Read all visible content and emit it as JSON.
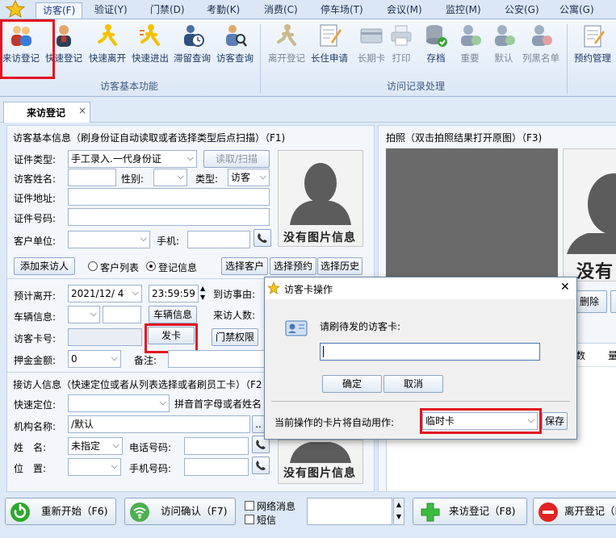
{
  "menu": {
    "tabs": [
      "访客(F)",
      "验证(Y)",
      "门禁(D)",
      "考勤(K)",
      "消费(C)",
      "停车场(T)",
      "会议(M)",
      "监控(M)",
      "公安(G)",
      "公寓(G)"
    ]
  },
  "ribbon": {
    "group1_label": "访客基本功能",
    "group2_label": "访问记录处理",
    "buttons": [
      "来访登记",
      "快速登记",
      "快速离开",
      "快速进出",
      "滞留查询",
      "访客查询",
      "离开登记",
      "长住申请",
      "长期卡",
      "打印",
      "存档",
      "重要",
      "默认",
      "列黑名单",
      "预约管理"
    ]
  },
  "doc_tab": {
    "label": "来访登记",
    "close": "×"
  },
  "visitor": {
    "section_title": "访客基本信息（刷身份证自动读取或者选择类型后点扫描）（F1)",
    "id_type_label": "证件类型:",
    "id_type_value": "手工录入.一代身份证",
    "read_scan": "读取/扫描",
    "name_label": "访客姓名:",
    "gender_label": "性别:",
    "type_label": "类型:",
    "type_value": "访客",
    "address_label": "证件地址:",
    "id_number_label": "证件号码:",
    "company_label": "客户单位:",
    "phone_label": "手机:",
    "no_photo": "没有图片信息",
    "add_visitor": "添加来访人",
    "radio_client_list": "客户列表",
    "radio_registered": "登记信息",
    "select_client": "选择客户",
    "select_booking": "选择预约",
    "select_history": "选择历史"
  },
  "visit": {
    "expected_leave_label": "预计离开:",
    "date_value": "2021/12/  4",
    "time_value": "23:59:59",
    "reason_label": "到访事由:",
    "vehicle_label": "车辆信息:",
    "vehicle_btn": "车辆信息",
    "visitor_count_label": "来访人数:",
    "card_label": "访客卡号:",
    "issue_card_btn": "发卡",
    "door_perm_btn": "门禁权限",
    "deposit_label": "押金金额:",
    "deposit_value": "0",
    "remark_label": "备注:"
  },
  "host": {
    "section_title": "接访人信息（快速定位或者从列表选择或者刷员工卡）（F2",
    "locate_label": "快速定位:",
    "pinyin_hint": "拼音首字母或者姓名",
    "org_label": "机构名称:",
    "org_value": "/默认",
    "name_label": "姓　名:",
    "name_value": "未指定",
    "tel_label": "电话号码:",
    "position_label": "位　置:",
    "mobile_label": "手机号码:",
    "no_photo": "没有图片信息"
  },
  "photo_panel": {
    "title": "拍照（双击拍照结果打开原图）（F3)",
    "no_photo_partial": "没有",
    "delete_btn": "删除",
    "col_count": "数",
    "col_weight": "量"
  },
  "dialog": {
    "title": "访客卡操作",
    "close": "✕",
    "prompt": "请刷待发的访客卡:",
    "ok": "确定",
    "cancel": "取消",
    "usage_label": "当前操作的卡片将自动用作:",
    "usage_value": "临时卡",
    "save": "保存"
  },
  "bottom": {
    "restart": "重新开始（F6)",
    "confirm": "访问确认（F7)",
    "network_msg": "网络消息",
    "sms": "短信",
    "register": "来访登记（F8)",
    "leave": "离开登记（F"
  },
  "colors": {
    "highlight": "#e3141f",
    "accent": "#1b3b8b",
    "photo_bg": "#6a6a6a"
  }
}
